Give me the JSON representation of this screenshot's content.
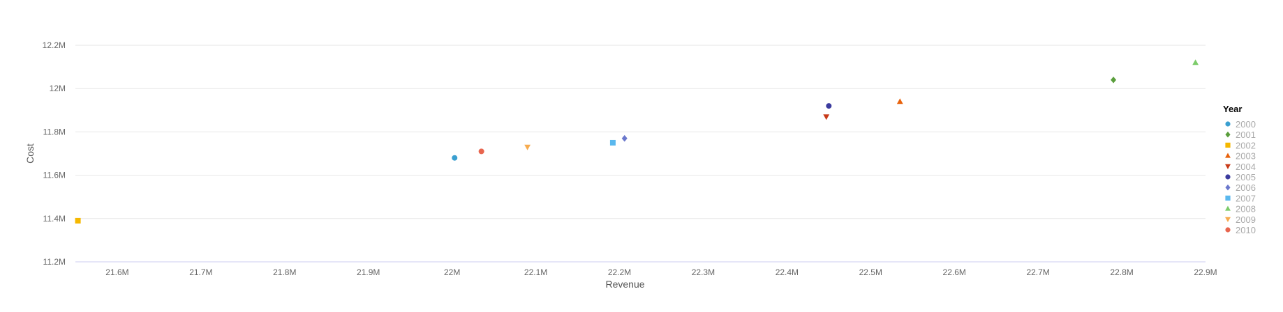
{
  "chart_data": {
    "type": "scatter",
    "xlabel": "Revenue",
    "ylabel": "Cost",
    "xlim": [
      21.55,
      22.9
    ],
    "ylim": [
      11.2,
      12.2
    ],
    "x_ticks": [
      21.6,
      21.7,
      21.8,
      21.9,
      22.0,
      22.1,
      22.2,
      22.3,
      22.4,
      22.5,
      22.6,
      22.7,
      22.8,
      22.9
    ],
    "x_tick_labels": [
      "21.6M",
      "21.7M",
      "21.8M",
      "21.9M",
      "22M",
      "22.1M",
      "22.2M",
      "22.3M",
      "22.4M",
      "22.5M",
      "22.6M",
      "22.7M",
      "22.8M",
      "22.9M"
    ],
    "y_ticks": [
      11.2,
      11.4,
      11.6,
      11.8,
      12.0,
      12.2
    ],
    "y_tick_labels": [
      "11.2M",
      "11.4M",
      "11.6M",
      "11.8M",
      "12M",
      "12.2M"
    ],
    "grid": "horizontal",
    "legend": {
      "title": "Year",
      "placement": "right"
    },
    "series": [
      {
        "name": "2000",
        "x": 22.003,
        "y": 11.68,
        "color": "#3a9fd0",
        "marker": "circle"
      },
      {
        "name": "2001",
        "x": 22.79,
        "y": 12.04,
        "color": "#5a9e3c",
        "marker": "diamond"
      },
      {
        "name": "2002",
        "x": 21.553,
        "y": 11.39,
        "color": "#f5b800",
        "marker": "square"
      },
      {
        "name": "2003",
        "x": 22.535,
        "y": 11.94,
        "color": "#e8620c",
        "marker": "triangle-up"
      },
      {
        "name": "2004",
        "x": 22.447,
        "y": 11.87,
        "color": "#c83a18",
        "marker": "triangle-down"
      },
      {
        "name": "2005",
        "x": 22.45,
        "y": 11.92,
        "color": "#3b3b9e",
        "marker": "circle"
      },
      {
        "name": "2006",
        "x": 22.206,
        "y": 11.77,
        "color": "#6b78cc",
        "marker": "diamond"
      },
      {
        "name": "2007",
        "x": 22.192,
        "y": 11.75,
        "color": "#5ab8ee",
        "marker": "square"
      },
      {
        "name": "2008",
        "x": 22.888,
        "y": 12.12,
        "color": "#7ccc6a",
        "marker": "triangle-up"
      },
      {
        "name": "2009",
        "x": 22.09,
        "y": 11.73,
        "color": "#f7ab4e",
        "marker": "triangle-down"
      },
      {
        "name": "2010",
        "x": 22.035,
        "y": 11.71,
        "color": "#e8654e",
        "marker": "circle"
      }
    ]
  }
}
